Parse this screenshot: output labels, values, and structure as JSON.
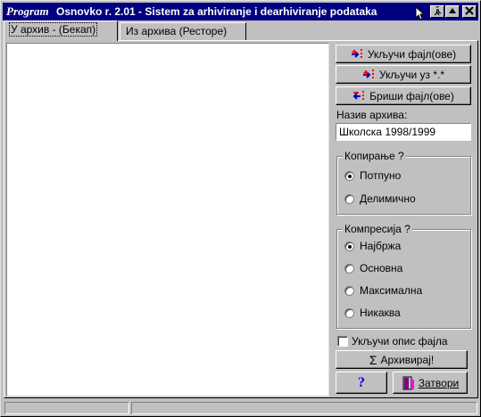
{
  "window": {
    "title_italic": "Program",
    "title": "Osnovko r. 2.01 - Sistem za arhiviranje i dearhiviranje podataka"
  },
  "tabs": [
    {
      "label": "У архив - (Бекап)",
      "active": true
    },
    {
      "label": "Из архива (Ресторе)",
      "active": false
    }
  ],
  "actions": {
    "include_files": "Укључи фајл(ове)",
    "include_with": "Укључи уз  *.*",
    "delete_files": "Бриши фајл(ове)"
  },
  "archive_name": {
    "label": "Назив архива:",
    "value": "Школска 1998/1999"
  },
  "copy_group": {
    "legend": "Копирање ?",
    "options": [
      {
        "label": "Потпуно",
        "selected": true
      },
      {
        "label": "Делимично",
        "selected": false
      }
    ]
  },
  "compression_group": {
    "legend": "Компресија ?",
    "options": [
      {
        "label": "Најбржа",
        "selected": true
      },
      {
        "label": "Основна",
        "selected": false
      },
      {
        "label": "Максимална",
        "selected": false
      },
      {
        "label": "Никаква",
        "selected": false
      }
    ]
  },
  "include_description": {
    "label": "Укључи опис фајла",
    "checked": false
  },
  "archive_button": {
    "icon": "Σ",
    "label": "Архивирај!"
  },
  "help_button": {
    "label": "?"
  },
  "close_button": {
    "label": "Затвори"
  },
  "colors": {
    "titlebar": "#000080",
    "face": "#c0c0c0",
    "help": "#0000ff",
    "icon_red": "#ff0000",
    "icon_blue": "#0000c0"
  }
}
